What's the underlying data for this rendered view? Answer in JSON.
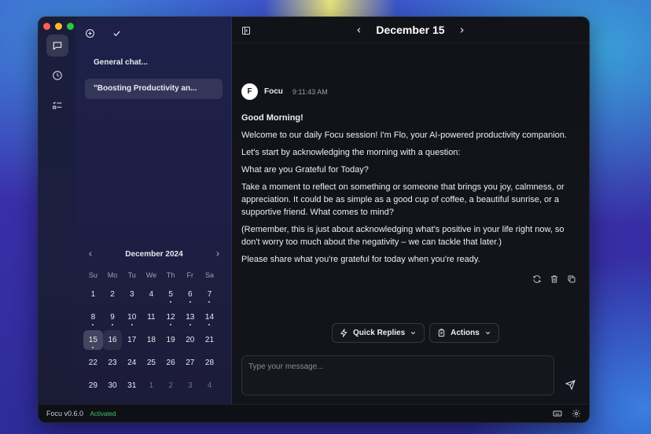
{
  "window": {
    "traffic_colors": [
      "#ff5f57",
      "#febc2e",
      "#28c840"
    ]
  },
  "rail": {
    "items": [
      {
        "name": "chat-icon",
        "active": true
      },
      {
        "name": "clock-icon",
        "active": false
      },
      {
        "name": "tasks-icon",
        "active": false
      }
    ]
  },
  "sidebar": {
    "chats": [
      {
        "title": "General chat...",
        "selected": false
      },
      {
        "title": "\"Boosting Productivity an...",
        "selected": true
      }
    ]
  },
  "calendar": {
    "month_label": "December 2024",
    "weekdays": [
      "Su",
      "Mo",
      "Tu",
      "We",
      "Th",
      "Fr",
      "Sa"
    ],
    "weeks": [
      [
        {
          "d": "1"
        },
        {
          "d": "2"
        },
        {
          "d": "3"
        },
        {
          "d": "4"
        },
        {
          "d": "5",
          "dot": true
        },
        {
          "d": "6",
          "dot": true
        },
        {
          "d": "7",
          "dot": true
        }
      ],
      [
        {
          "d": "8",
          "dot": true
        },
        {
          "d": "9",
          "dot": true
        },
        {
          "d": "10",
          "dot": true
        },
        {
          "d": "11"
        },
        {
          "d": "12",
          "dot": true
        },
        {
          "d": "13",
          "dot": true
        },
        {
          "d": "14",
          "dot": true
        }
      ],
      [
        {
          "d": "15",
          "today": true,
          "dot": true
        },
        {
          "d": "16",
          "sel": true
        },
        {
          "d": "17"
        },
        {
          "d": "18"
        },
        {
          "d": "19"
        },
        {
          "d": "20"
        },
        {
          "d": "21"
        }
      ],
      [
        {
          "d": "22"
        },
        {
          "d": "23"
        },
        {
          "d": "24"
        },
        {
          "d": "25"
        },
        {
          "d": "26"
        },
        {
          "d": "27"
        },
        {
          "d": "28"
        }
      ],
      [
        {
          "d": "29"
        },
        {
          "d": "30"
        },
        {
          "d": "31"
        },
        {
          "d": "1",
          "muted": true
        },
        {
          "d": "2",
          "muted": true
        },
        {
          "d": "3",
          "muted": true
        },
        {
          "d": "4",
          "muted": true
        }
      ]
    ]
  },
  "header": {
    "date": "December 15"
  },
  "message": {
    "avatar_letter": "F",
    "author": "Focu",
    "time": "9:11:43 AM",
    "greeting": "Good Morning!",
    "paragraphs": [
      "Welcome to our daily Focu session! I'm Flo, your AI-powered productivity companion.",
      "Let's start by acknowledging the morning with a question:",
      "What are you Grateful for Today?",
      "Take a moment to reflect on something or someone that brings you joy, calmness, or appreciation. It could be as simple as a good cup of coffee, a beautiful sunrise, or a supportive friend. What comes to mind?",
      "(Remember, this is just about acknowledging what's positive in your life right now, so don't worry too much about the negativity – we can tackle that later.)",
      "Please share what you're grateful for today when you're ready."
    ]
  },
  "controls": {
    "quick_replies": "Quick Replies",
    "actions": "Actions"
  },
  "composer": {
    "placeholder": "Type your message..."
  },
  "footer": {
    "version": "Focu v0.6.0",
    "status": "Activated"
  }
}
